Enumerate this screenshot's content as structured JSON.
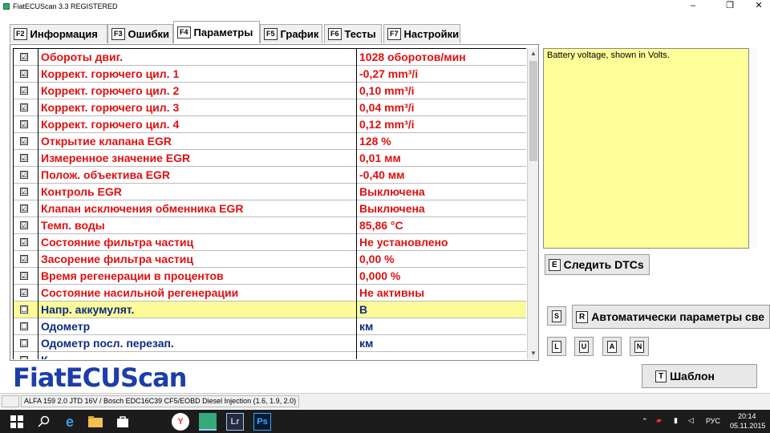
{
  "window": {
    "title": "FiatECUScan 3.3 REGISTERED",
    "minimize": "–",
    "maximize": "❐",
    "close": "✕"
  },
  "tabs": [
    {
      "key": "F2",
      "label": "Информация"
    },
    {
      "key": "F3",
      "label": "Ошибки"
    },
    {
      "key": "F4",
      "label": "Параметры"
    },
    {
      "key": "F5",
      "label": "График"
    },
    {
      "key": "F6",
      "label": "Тесты"
    },
    {
      "key": "F7",
      "label": "Настройки"
    }
  ],
  "params": [
    {
      "checked": "☑",
      "name": "Обороты двиг.",
      "value": "1028 оборотов/мин"
    },
    {
      "checked": "☑",
      "name": "Коррект. горючего цил. 1",
      "value": "-0,27 mm³/i"
    },
    {
      "checked": "☑",
      "name": "Коррект. горючего цил. 2",
      "value": "0,10 mm³/i"
    },
    {
      "checked": "☑",
      "name": "Коррект. горючего цил. 3",
      "value": "0,04 mm³/i"
    },
    {
      "checked": "☑",
      "name": "Коррект. горючего цил. 4",
      "value": "0,12 mm³/i"
    },
    {
      "checked": "☑",
      "name": "Открытие клапана EGR",
      "value": "128 %"
    },
    {
      "checked": "☑",
      "name": "Измеренное значение EGR",
      "value": "0,01 мм"
    },
    {
      "checked": "☑",
      "name": "Полож. объектива EGR",
      "value": "-0,40 мм"
    },
    {
      "checked": "☑",
      "name": "Контроль EGR",
      "value": "Выключена"
    },
    {
      "checked": "☑",
      "name": "Клапан исключения обменника EGR",
      "value": "Выключена"
    },
    {
      "checked": "☑",
      "name": "Темп. воды",
      "value": "85,86 °C"
    },
    {
      "checked": "☑",
      "name": "Состояние фильтра частиц",
      "value": "Не установлено"
    },
    {
      "checked": "☑",
      "name": "Засорение фильтра частиц",
      "value": "0,00 %"
    },
    {
      "checked": "☑",
      "name": "Время регенерации в процентов",
      "value": "0,000 %"
    },
    {
      "checked": "☑",
      "name": "Состояние насильной регенерации",
      "value": "Не активны"
    },
    {
      "checked": "☐",
      "name": "Напр. аккумулят.",
      "value": "В"
    },
    {
      "checked": "☐",
      "name": "Одометр",
      "value": "км"
    },
    {
      "checked": "☐",
      "name": "Одометр посл. перезап.",
      "value": "км"
    },
    {
      "checked": "☐",
      "name": "К",
      "value": ""
    }
  ],
  "scrollbar": {
    "up": "▲",
    "down": "▼"
  },
  "description": "Battery voltage, shown in Volts.",
  "buttons": {
    "watch_dtc": {
      "key": "E",
      "label": "Следить DTCs"
    },
    "s": {
      "key": "S"
    },
    "auto_params": {
      "key": "R",
      "label": "Автоматически параметры све"
    },
    "l": {
      "key": "L"
    },
    "u": {
      "key": "U"
    },
    "a": {
      "key": "A"
    },
    "n": {
      "key": "N"
    },
    "template": {
      "key": "T",
      "label": "Шаблон"
    }
  },
  "logo": "FiatECUScan",
  "status": {
    "vehicle": "ALFA 159 2.0 JTD 16V / Bosch EDC16C39 CF5/EOBD Diesel Injection (1.6, 1.9, 2.0)"
  },
  "taskbar": {
    "lang": "РУС",
    "time": "20:14",
    "date": "05.11.2015",
    "icons": [
      "windows-icon",
      "search-icon",
      "edge-icon",
      "explorer-icon",
      "store-icon",
      "yandex-icon",
      "fiatecuscan-icon",
      "lightroom-icon",
      "photoshop-icon"
    ],
    "lr": "Lr",
    "ps": "Ps",
    "ya": "Y"
  },
  "colors": {
    "param_name": "#e01010",
    "selected_row": "#fbfb9a",
    "unchecked_text": "#102a80",
    "description_bg": "#ffff99",
    "logo": "#1d3da8"
  }
}
